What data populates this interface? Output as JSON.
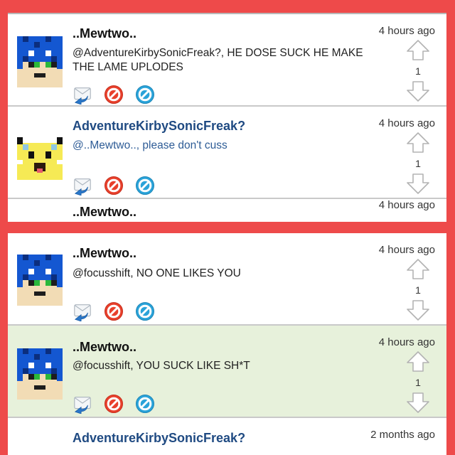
{
  "posts": [
    {
      "author": "..Mewtwo..",
      "time": "4 hours ago",
      "message": "@AdventureKirbySonicFreak?, HE DOSE SUCK HE MAKE THE LAME UPLODES",
      "votes": "1"
    },
    {
      "author": "AdventureKirbySonicFreak?",
      "time": "4 hours ago",
      "message": "@..Mewtwo.., please don't cuss",
      "votes": "1"
    },
    {
      "author": "..Mewtwo..",
      "time": "4 hours ago"
    },
    {
      "author": "..Mewtwo..",
      "time": "4 hours ago",
      "message": "@focusshift, NO ONE LIKES YOU",
      "votes": "1"
    },
    {
      "author": "..Mewtwo..",
      "time": "4 hours ago",
      "message": "@focusshift, YOU SUCK LIKE SH*T",
      "votes": "1"
    },
    {
      "author": "AdventureKirbySonicFreak?",
      "time": "2 months ago"
    }
  ],
  "icons": {
    "reply": "reply-envelope-icon",
    "block": "block-icon",
    "report": "report-icon",
    "upvote": "upvote-arrow-icon",
    "downvote": "downvote-arrow-icon"
  },
  "colors": {
    "frame": "#ee4a4a",
    "highlight_row": "#e7f1db",
    "author_link": "#1f4a82",
    "block_red": "#e8402c",
    "report_blue": "#2aa3d9"
  }
}
